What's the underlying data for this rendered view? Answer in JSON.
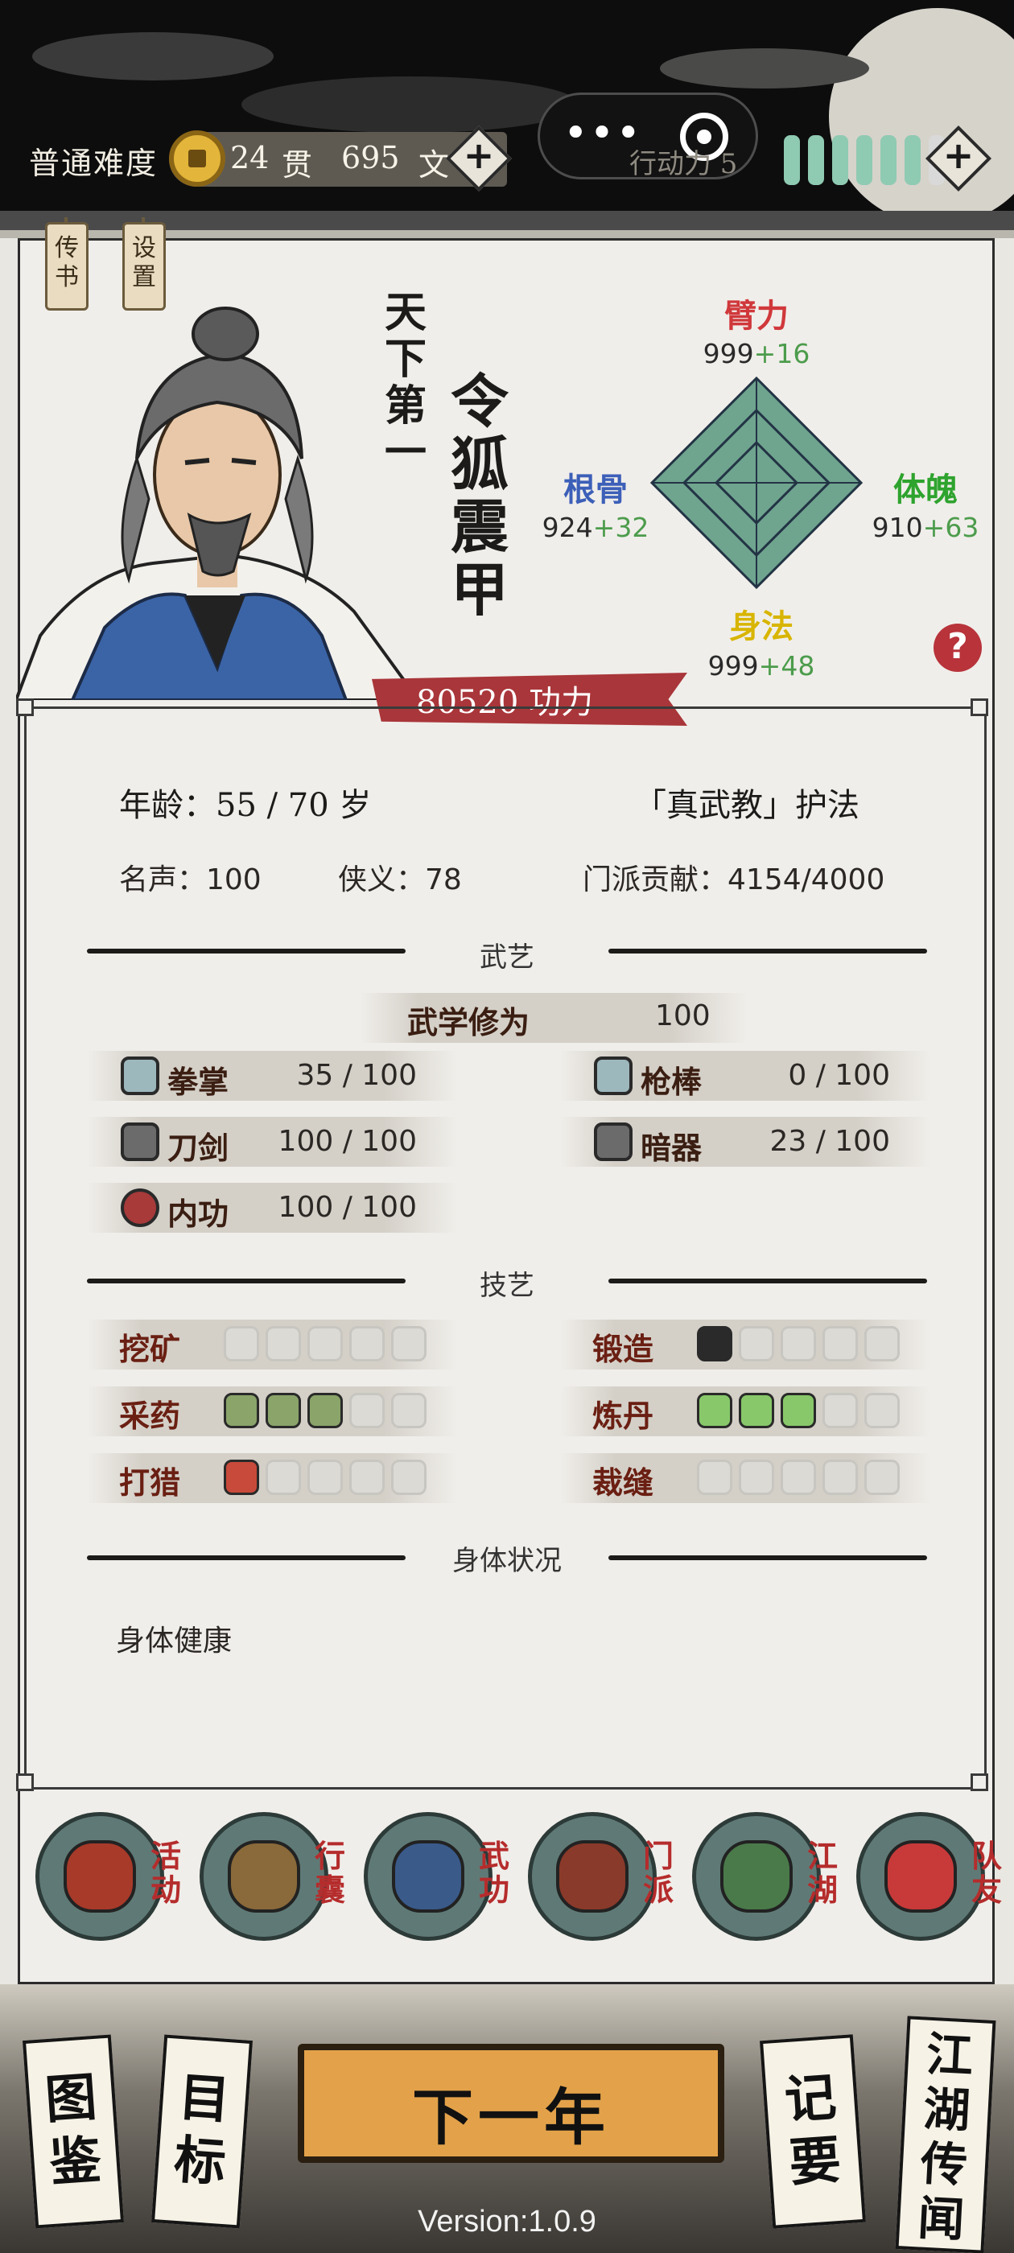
{
  "topbar": {
    "difficulty": "普通难度",
    "money_guan": "24",
    "money_guan_unit": "贯",
    "money_wen": "695",
    "money_wen_unit": "文",
    "action_label": "行动力 5",
    "energy_full": 6,
    "energy_total": 7
  },
  "tags": [
    "传\n书",
    "设\n置"
  ],
  "character": {
    "title": "天下第一",
    "name": "令狐震甲",
    "power_value": "80520",
    "power_label": "功力"
  },
  "radar": {
    "top": {
      "name": "臂力",
      "base": "999",
      "bonus": "+16",
      "color": "#d0383b"
    },
    "left": {
      "name": "根骨",
      "base": "924",
      "bonus": "+32",
      "color": "#3c5fb8"
    },
    "right": {
      "name": "体魄",
      "base": "910",
      "bonus": "+63",
      "color": "#2ea32e"
    },
    "bottom": {
      "name": "身法",
      "base": "999",
      "bonus": "+48",
      "color": "#d8b500"
    }
  },
  "help": "?",
  "info": {
    "age": "年龄：55 / 70 岁",
    "sect_role": "「真武教」护法",
    "fame": "名声：100",
    "chivalry": "侠义：78",
    "contribution": "门派贡献：4154/4000"
  },
  "martial": {
    "section_title": "武艺",
    "cultivation_label": "武学修为",
    "cultivation_value": "100",
    "skills": [
      {
        "name": "拳掌",
        "value": "35 / 100",
        "icon": "fist-icon"
      },
      {
        "name": "枪棒",
        "value": "0 / 100",
        "icon": "spear-icon"
      },
      {
        "name": "刀剑",
        "value": "100 / 100",
        "icon": "sword-icon"
      },
      {
        "name": "暗器",
        "value": "23 / 100",
        "icon": "dart-icon"
      },
      {
        "name": "内功",
        "value": "100 / 100",
        "icon": "inner-power-icon"
      }
    ]
  },
  "crafts": {
    "section_title": "技艺",
    "items": [
      {
        "name": "挖矿",
        "level": 0,
        "icon": "pickaxe-icon"
      },
      {
        "name": "锻造",
        "level": 1,
        "icon": "anvil-icon"
      },
      {
        "name": "采药",
        "level": 3,
        "icon": "herb-icon"
      },
      {
        "name": "炼丹",
        "level": 3,
        "icon": "bowl-icon"
      },
      {
        "name": "打猎",
        "level": 1,
        "icon": "bow-icon"
      },
      {
        "name": "裁缝",
        "level": 0,
        "icon": "needle-icon"
      }
    ]
  },
  "health": {
    "section_title": "身体状况",
    "status": "身体健康"
  },
  "menu": [
    {
      "label": "活\n动",
      "icon": "gourd-icon"
    },
    {
      "label": "行\n囊",
      "icon": "bag-icon"
    },
    {
      "label": "武\n功",
      "icon": "scroll-icon"
    },
    {
      "label": "门\n派",
      "icon": "temple-icon"
    },
    {
      "label": "江\n湖",
      "icon": "mountain-icon"
    },
    {
      "label": "队\n友",
      "icon": "flag-icon"
    }
  ],
  "bottom_nav": {
    "atlas": "图\n鉴",
    "goals": "目\n标",
    "next_year": "下一年",
    "notes": "记\n要",
    "rumors": "江\n湖\n传\n闻"
  },
  "version": "Version:1.0.9"
}
